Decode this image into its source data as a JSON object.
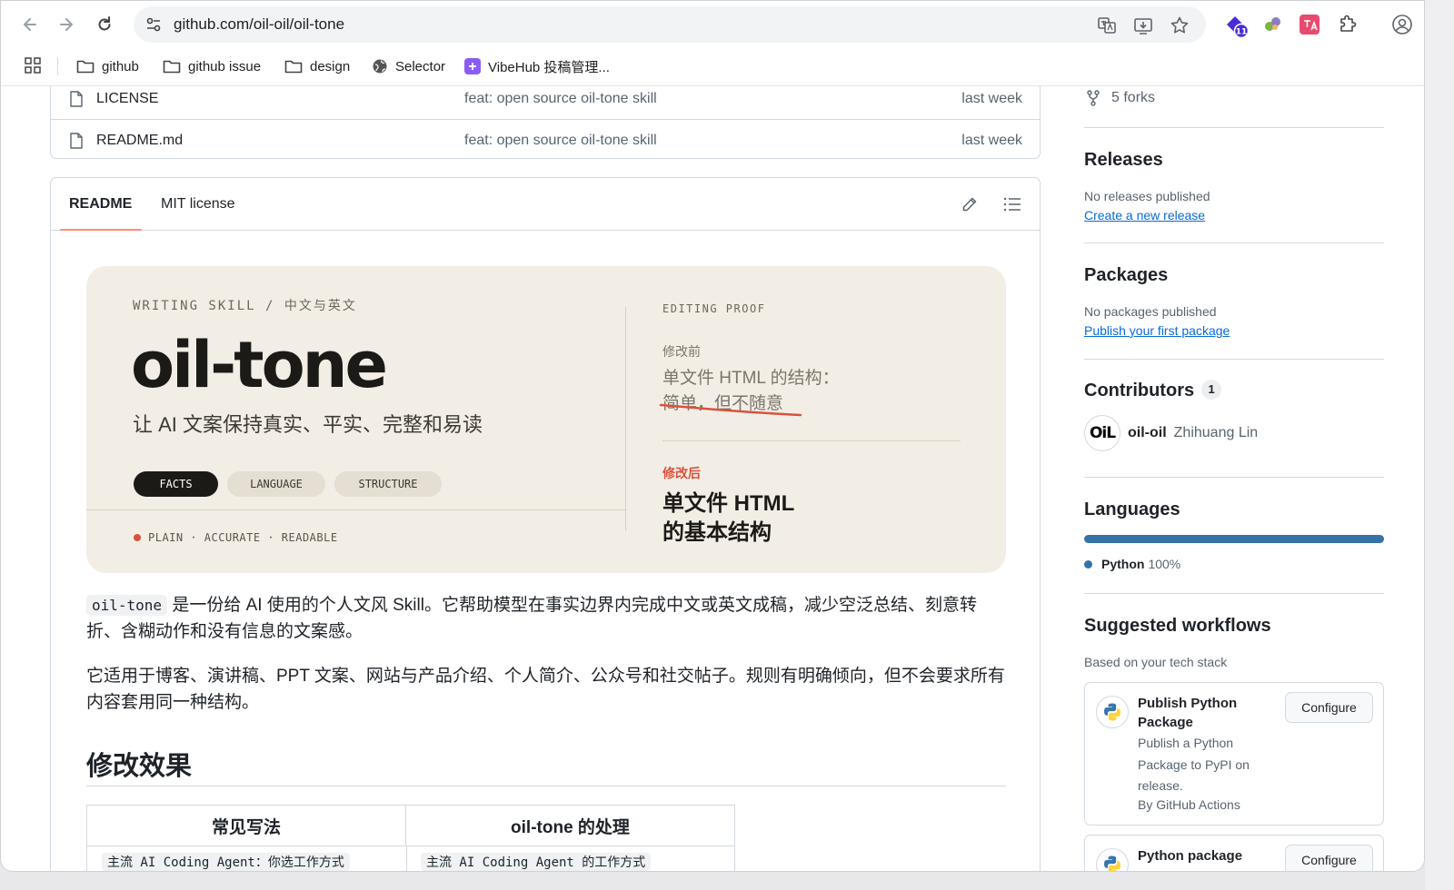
{
  "browser": {
    "url": "github.com/oil-oil/oil-tone",
    "extension_badge": "11",
    "bookmarks": [
      {
        "label": "github",
        "icon": "folder-icon"
      },
      {
        "label": "github issue",
        "icon": "folder-icon"
      },
      {
        "label": "design",
        "icon": "folder-icon"
      },
      {
        "label": "Selector",
        "icon": "globe-icon"
      },
      {
        "label": "VibeHub 投稿管理...",
        "icon": "vibehub-icon"
      }
    ]
  },
  "files": [
    {
      "name": "LICENSE",
      "message": "feat: open source oil-tone skill",
      "date": "last week"
    },
    {
      "name": "README.md",
      "message": "feat: open source oil-tone skill",
      "date": "last week"
    }
  ],
  "readme": {
    "tabs": [
      "README",
      "MIT license"
    ],
    "hero": {
      "kicker": "WRITING SKILL / 中文与英文",
      "title": "oil-tone",
      "subtitle": "让 AI 文案保持真实、平实、完整和易读",
      "pills": [
        "FACTS",
        "LANGUAGE",
        "STRUCTURE"
      ],
      "footer": "PLAIN · ACCURATE · READABLE",
      "proof_label": "EDITING PROOF",
      "before_label": "修改前",
      "before_line1": "单文件 HTML 的结构：",
      "before_line2": "简单，但不随意",
      "after_label": "修改后",
      "after_line1": "单文件 HTML",
      "after_line2": "的基本结构"
    },
    "para1_code": "oil-tone",
    "para1_rest": "是一份给 AI 使用的个人文风 Skill。它帮助模型在事实边界内完成中文或英文成稿，减少空泛总结、刻意转折、含糊动作和没有信息的文案感。",
    "para2": "它适用于博客、演讲稿、PPT 文案、网站与产品介绍、个人简介、公众号和社交帖子。规则有明确倾向，但不会要求所有内容套用同一种结构。",
    "h2": "修改效果",
    "table": {
      "headers": [
        "常见写法",
        "oil-tone 的处理"
      ],
      "row1": [
        "主流 AI Coding Agent：你选工作方式",
        "主流 AI Coding Agent 的工作方式"
      ]
    }
  },
  "sidebar": {
    "forks": "5 forks",
    "releases": {
      "title": "Releases",
      "text": "No releases published",
      "link": "Create a new release"
    },
    "packages": {
      "title": "Packages",
      "text": "No packages published",
      "link": "Publish your first package"
    },
    "contributors": {
      "title": "Contributors",
      "count": "1",
      "login": "oil-oil",
      "fullname": "Zhihuang Lin",
      "avatar_text": "OiL"
    },
    "languages": {
      "title": "Languages",
      "name": "Python",
      "percent": "100%",
      "color": "#3572a5"
    },
    "workflows": {
      "title": "Suggested workflows",
      "subtitle": "Based on your tech stack",
      "items": [
        {
          "title": "Publish Python Package",
          "desc": "Publish a Python Package to PyPI on release.",
          "by": "By GitHub Actions",
          "button": "Configure"
        },
        {
          "title": "Python package",
          "button": "Configure"
        }
      ]
    }
  }
}
